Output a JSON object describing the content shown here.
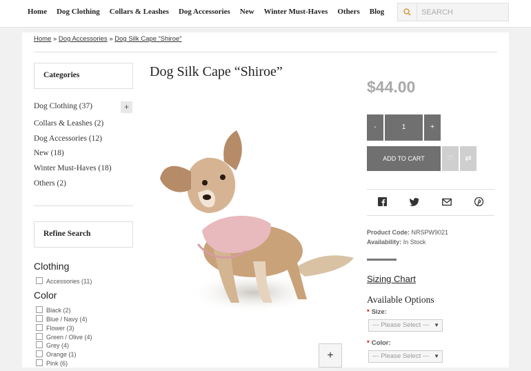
{
  "nav": {
    "items": [
      "Home",
      "Dog Clothing",
      "Collars & Leashes",
      "Dog Accessories",
      "New",
      "Winter Must-Haves",
      "Others",
      "Blog"
    ],
    "search_placeholder": "SEARCH",
    "search_icon": "search-icon"
  },
  "breadcrumb": {
    "home": "Home",
    "sep1": "»",
    "category": "Dog Accessories",
    "sep2": "»",
    "current": "Dog Silk Cape “Shiroe”"
  },
  "sidebar": {
    "categories_title": "Categories",
    "categories": [
      "Dog Clothing (37)",
      "Collars & Leashes (2)",
      "Dog Accessories (12)",
      "New (18)",
      "Winter Must-Haves (18)",
      "Others (2)"
    ],
    "expand_label": "+",
    "refine_title": "Refine Search",
    "clothing_heading": "Clothing",
    "clothing_options": [
      "Accessories (11)"
    ],
    "color_heading": "Color",
    "color_options": [
      "Black (2)",
      "Blue / Navy (4)",
      "Flower (3)",
      "Green / Olive (4)",
      "Grey (4)",
      "Orange (1)",
      "Pink (6)"
    ]
  },
  "product": {
    "title": "Dog Silk Cape “Shiroe”",
    "price": "$44.00",
    "qty_minus": "-",
    "qty_value": "1",
    "qty_plus": "+",
    "add_to_cart": "ADD TO CART",
    "product_code_label": "Product Code:",
    "product_code": "NRSPW9021",
    "availability_label": "Availability:",
    "availability": "In Stock",
    "sizing_chart": "Sizing Chart",
    "available_options": "Available Options",
    "size_label": "Size:",
    "color_label": "Color:",
    "required_mark": "*",
    "select_placeholder": "--- Please Select ---",
    "zoom_label": "+"
  },
  "colors": {
    "price": "#a9a9a9",
    "button": "#707070",
    "search_icon": "#d4a043",
    "required": "#dd0000"
  }
}
